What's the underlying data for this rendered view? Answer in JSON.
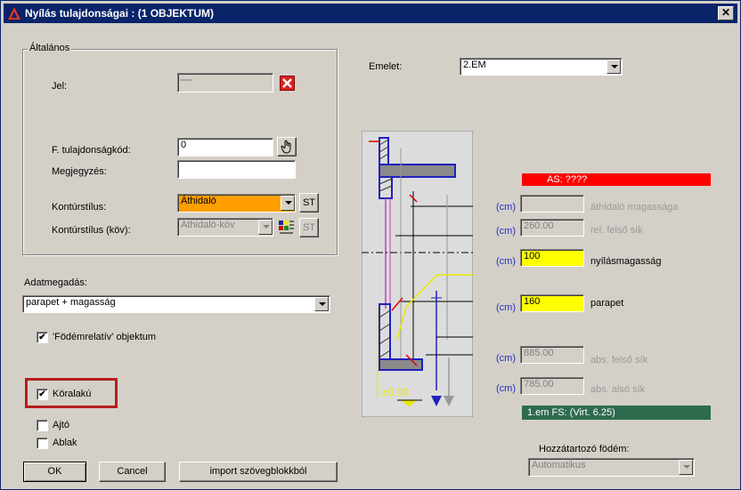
{
  "title": "Nyílás tulajdonságai : (1 OBJEKTUM)",
  "general": {
    "group_title": "Általános",
    "jel_label": "Jel:",
    "jel_value": "",
    "code_label": "F. tulajdonságkód:",
    "code_value": "0",
    "note_label": "Megjegyzés:",
    "note_value": "",
    "contour_label": "Kontúrstílus:",
    "contour_value": "Áthidaló",
    "contour_st": "ST",
    "contour_next_label": "Kontúrstílus (köv):",
    "contour_next_value": "Áthidaló-köv",
    "contour_next_st": "ST"
  },
  "floor": {
    "label": "Emelet:",
    "value": "2.EM"
  },
  "data_entry": {
    "label": "Adatmegadás:",
    "value": "parapet + magasság",
    "slab_relative_label": "'Födémrelatív' objektum",
    "slab_relative_checked": true
  },
  "shape": {
    "circular_label": "Köralakú",
    "circular_checked": true,
    "door_label": "Ajtó",
    "door_checked": false,
    "window_label": "Ablak",
    "window_checked": false
  },
  "buttons": {
    "ok": "OK",
    "cancel": "Cancel",
    "import": "import szövegblokkból"
  },
  "params": {
    "as_label": "AS: ????",
    "unit": "(cm)",
    "lintel_height_value": "",
    "lintel_height_label": "áthidaló magassága",
    "rel_top_value": "260.00",
    "rel_top_label": "rel. felső sík",
    "opening_height_value": "100",
    "opening_height_label": "nyílásmagasság",
    "parapet_value": "160",
    "parapet_label": "parapet",
    "abs_top_value": "885.00",
    "abs_top_label": "abs. felső sík",
    "abs_bottom_value": "785.00",
    "abs_bottom_label": "abs. alsó sík",
    "fs_label": "1.em FS: (Virt. 6.25)"
  },
  "diagram": {
    "zero_label": "±0.00"
  },
  "slab": {
    "label": "Hozzátartozó födém:",
    "value": "Automatikus"
  },
  "colors": {
    "title_bg": "#0a246a",
    "as_bg": "#ff0000",
    "fs_bg": "#2e6b4e",
    "highlight": "#b41e1e"
  }
}
